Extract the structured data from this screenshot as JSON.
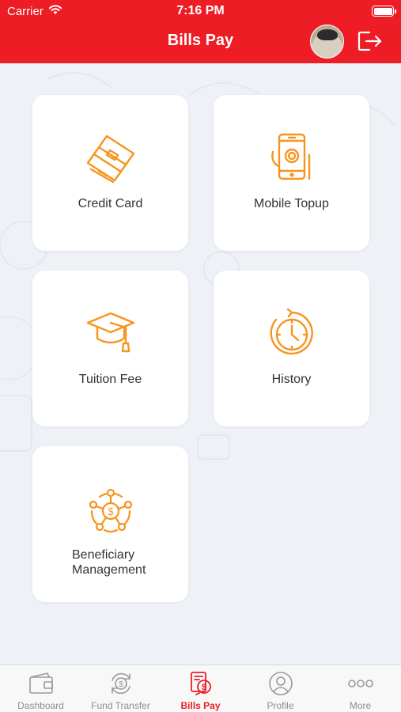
{
  "status_bar": {
    "carrier": "Carrier",
    "time": "7:16 PM"
  },
  "header": {
    "title": "Bills Pay"
  },
  "tiles": [
    {
      "label": "Credit Card",
      "icon": "credit-card-icon"
    },
    {
      "label": "Mobile Topup",
      "icon": "mobile-phone-icon"
    },
    {
      "label": "Tuition Fee",
      "icon": "graduation-cap-icon"
    },
    {
      "label": "History",
      "icon": "history-clock-icon"
    },
    {
      "label": "Beneficiary\nManagement",
      "icon": "beneficiary-network-icon"
    }
  ],
  "tabbar": [
    {
      "label": "Dashboard",
      "icon": "wallet-icon"
    },
    {
      "label": "Fund Transfer",
      "icon": "transfer-icon"
    },
    {
      "label": "Bills Pay",
      "icon": "bill-icon",
      "active": true
    },
    {
      "label": "Profile",
      "icon": "profile-icon"
    },
    {
      "label": "More",
      "icon": "more-dots-icon"
    }
  ],
  "colors": {
    "brand": "#ee1c25",
    "icon": "#f7941d",
    "tab_inactive": "#8e8e93"
  }
}
